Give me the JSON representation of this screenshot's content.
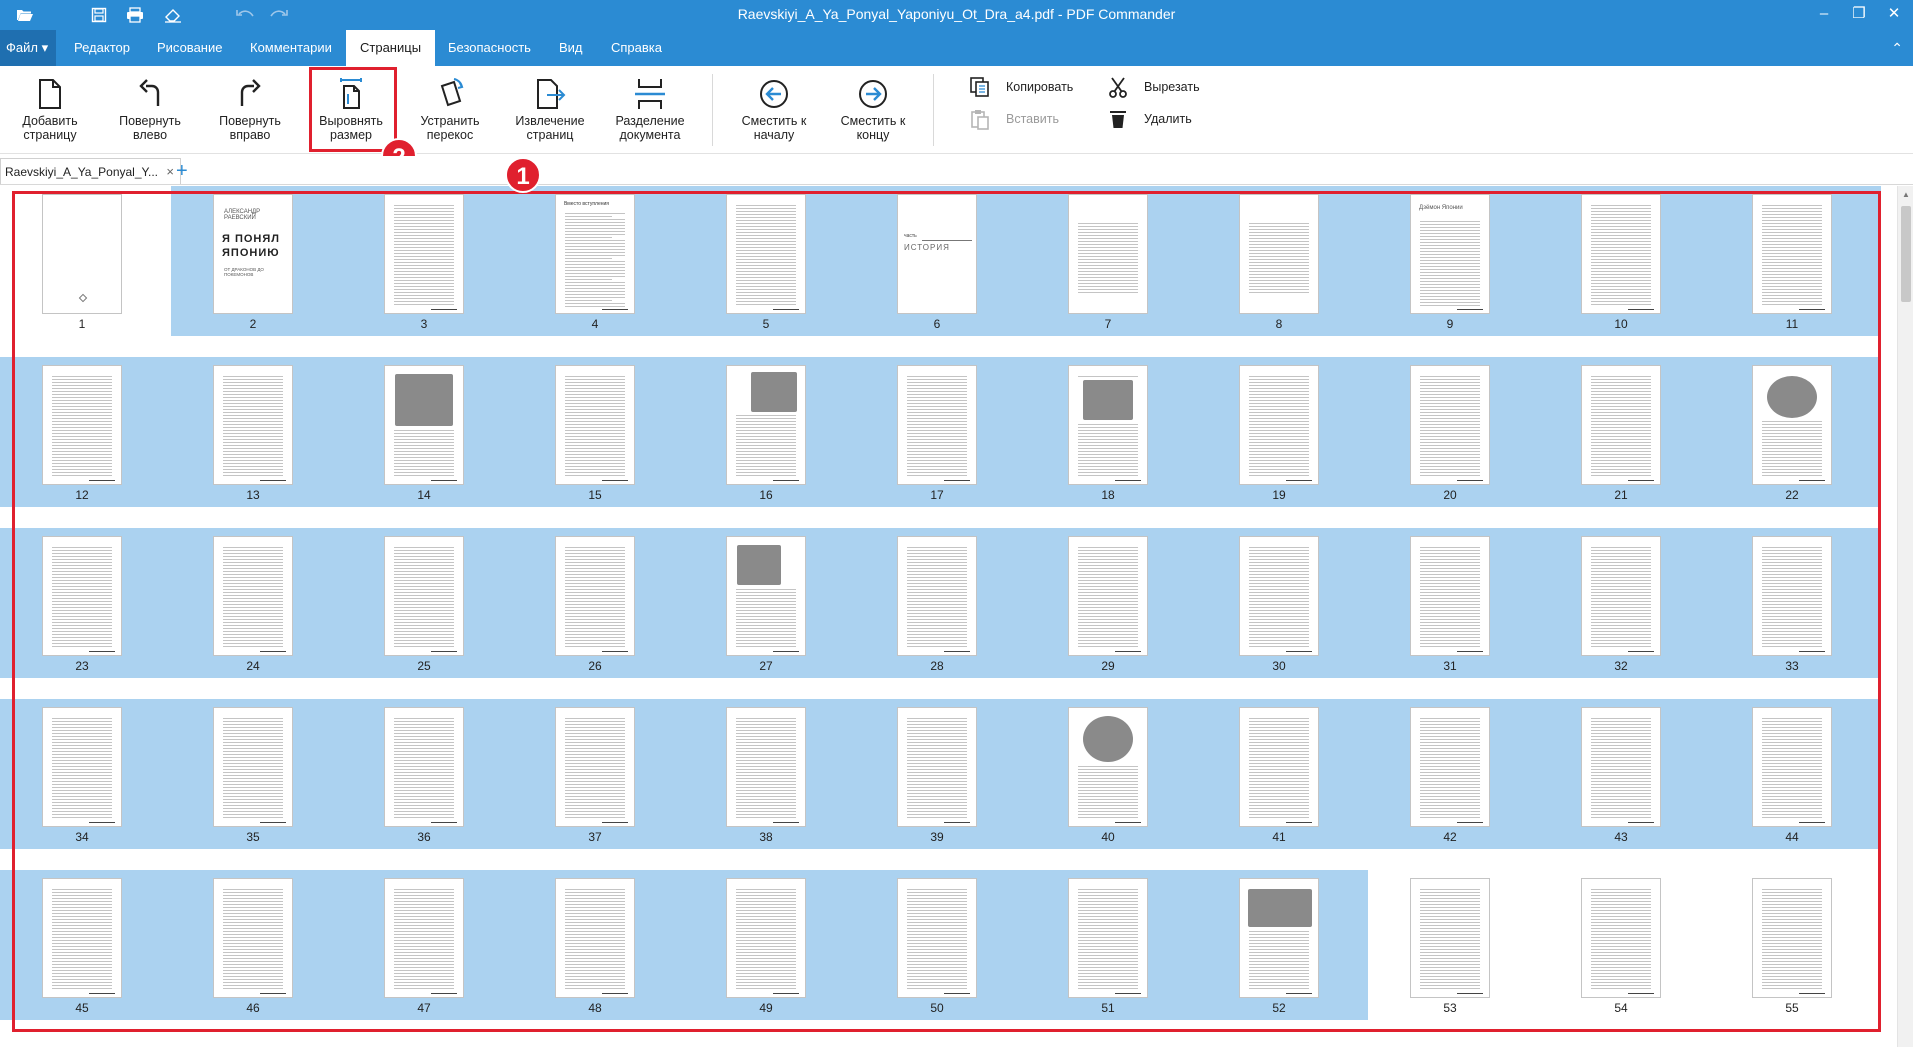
{
  "window": {
    "title": "Raevskiyi_A_Ya_Ponyal_Yaponiyu_Ot_Dra_a4.pdf - PDF Commander",
    "quick_access_icons": [
      "folder-open-icon",
      "save-icon",
      "print-icon",
      "eraser-icon",
      "undo-icon",
      "redo-icon"
    ],
    "controls": {
      "minimize": "–",
      "restore": "❐",
      "close": "✕"
    }
  },
  "menu": {
    "file": "Файл",
    "items": [
      "Редактор",
      "Рисование",
      "Комментарии",
      "Страницы",
      "Безопасность",
      "Вид",
      "Справка"
    ],
    "active": "Страницы",
    "collapse": "⌃"
  },
  "ribbon": {
    "buttons": [
      {
        "id": "add-page",
        "label": "Добавить\nстраницу",
        "icon": "add-page-icon"
      },
      {
        "id": "rotate-left",
        "label": "Повернуть\nвлево",
        "icon": "rotate-left-icon"
      },
      {
        "id": "rotate-right",
        "label": "Повернуть\nвправо",
        "icon": "rotate-right-icon"
      },
      {
        "id": "align-size",
        "label": "Выровнять\nразмер",
        "icon": "align-size-icon"
      },
      {
        "id": "deskew",
        "label": "Устранить\nперекос",
        "icon": "deskew-icon"
      },
      {
        "id": "extract-pages",
        "label": "Извлечение\nстраниц",
        "icon": "extract-pages-icon"
      },
      {
        "id": "split-document",
        "label": "Разделение\nдокумента",
        "icon": "split-document-icon"
      },
      {
        "id": "move-to-start",
        "label": "Сместить к\nначалу",
        "icon": "move-to-start-icon"
      },
      {
        "id": "move-to-end",
        "label": "Сместить к\nконцу",
        "icon": "move-to-end-icon"
      }
    ],
    "small_buttons": [
      {
        "id": "copy",
        "label": "Копировать",
        "icon": "copy-icon",
        "enabled": true
      },
      {
        "id": "cut",
        "label": "Вырезать",
        "icon": "scissors-icon",
        "enabled": true
      },
      {
        "id": "paste",
        "label": "Вставить",
        "icon": "paste-icon",
        "enabled": false
      },
      {
        "id": "delete",
        "label": "Удалить",
        "icon": "trash-icon",
        "enabled": true
      }
    ]
  },
  "annotations": {
    "badge_1": "1",
    "badge_2": "2",
    "highlight_color": "#e0202e"
  },
  "doc_tab": {
    "label": "Raevskiyi_A_Ya_Ponyal_Y...",
    "close": "×",
    "add": "+"
  },
  "pages": {
    "numbers": [
      "1",
      "2",
      "3",
      "4",
      "5",
      "6",
      "7",
      "8",
      "9",
      "10",
      "11",
      "12",
      "13",
      "14",
      "15",
      "16",
      "17",
      "18",
      "19",
      "20",
      "21",
      "22",
      "23",
      "24",
      "25",
      "26",
      "27",
      "28",
      "29",
      "30",
      "31",
      "32",
      "33",
      "34",
      "35",
      "36",
      "37",
      "38",
      "39",
      "40",
      "41",
      "42",
      "43",
      "44",
      "45",
      "46",
      "47",
      "48",
      "49",
      "50",
      "51",
      "52",
      "53",
      "54",
      "55"
    ],
    "selected": [
      2,
      3,
      4,
      5,
      6,
      7,
      8,
      9,
      10,
      11,
      12,
      13,
      14,
      15,
      16,
      17,
      18,
      19,
      20,
      21,
      22,
      23,
      24,
      25,
      26,
      27,
      28,
      29,
      30,
      31,
      32,
      33,
      34,
      35,
      36,
      37,
      38,
      39,
      40,
      41,
      42,
      43,
      44,
      45,
      46,
      47,
      48,
      49,
      50,
      51,
      52
    ],
    "page2_cover": {
      "author": "АЛЕКСАНДР РАЕВСКИЙ",
      "title_line1": "Я ПОНЯЛ",
      "title_line2": "ЯПОНИЮ",
      "subtitle": "ОТ ДРАКОНОВ ДО ПОКЕМОНОВ"
    },
    "page6_heading": {
      "part": "часть",
      "title": "ИСТОРИЯ"
    },
    "page9_heading": "Дзёмон Японии",
    "page4_heading": "Вместо вступления"
  },
  "colors": {
    "accent": "#2b8bd3",
    "selection": "#abd2f0"
  }
}
